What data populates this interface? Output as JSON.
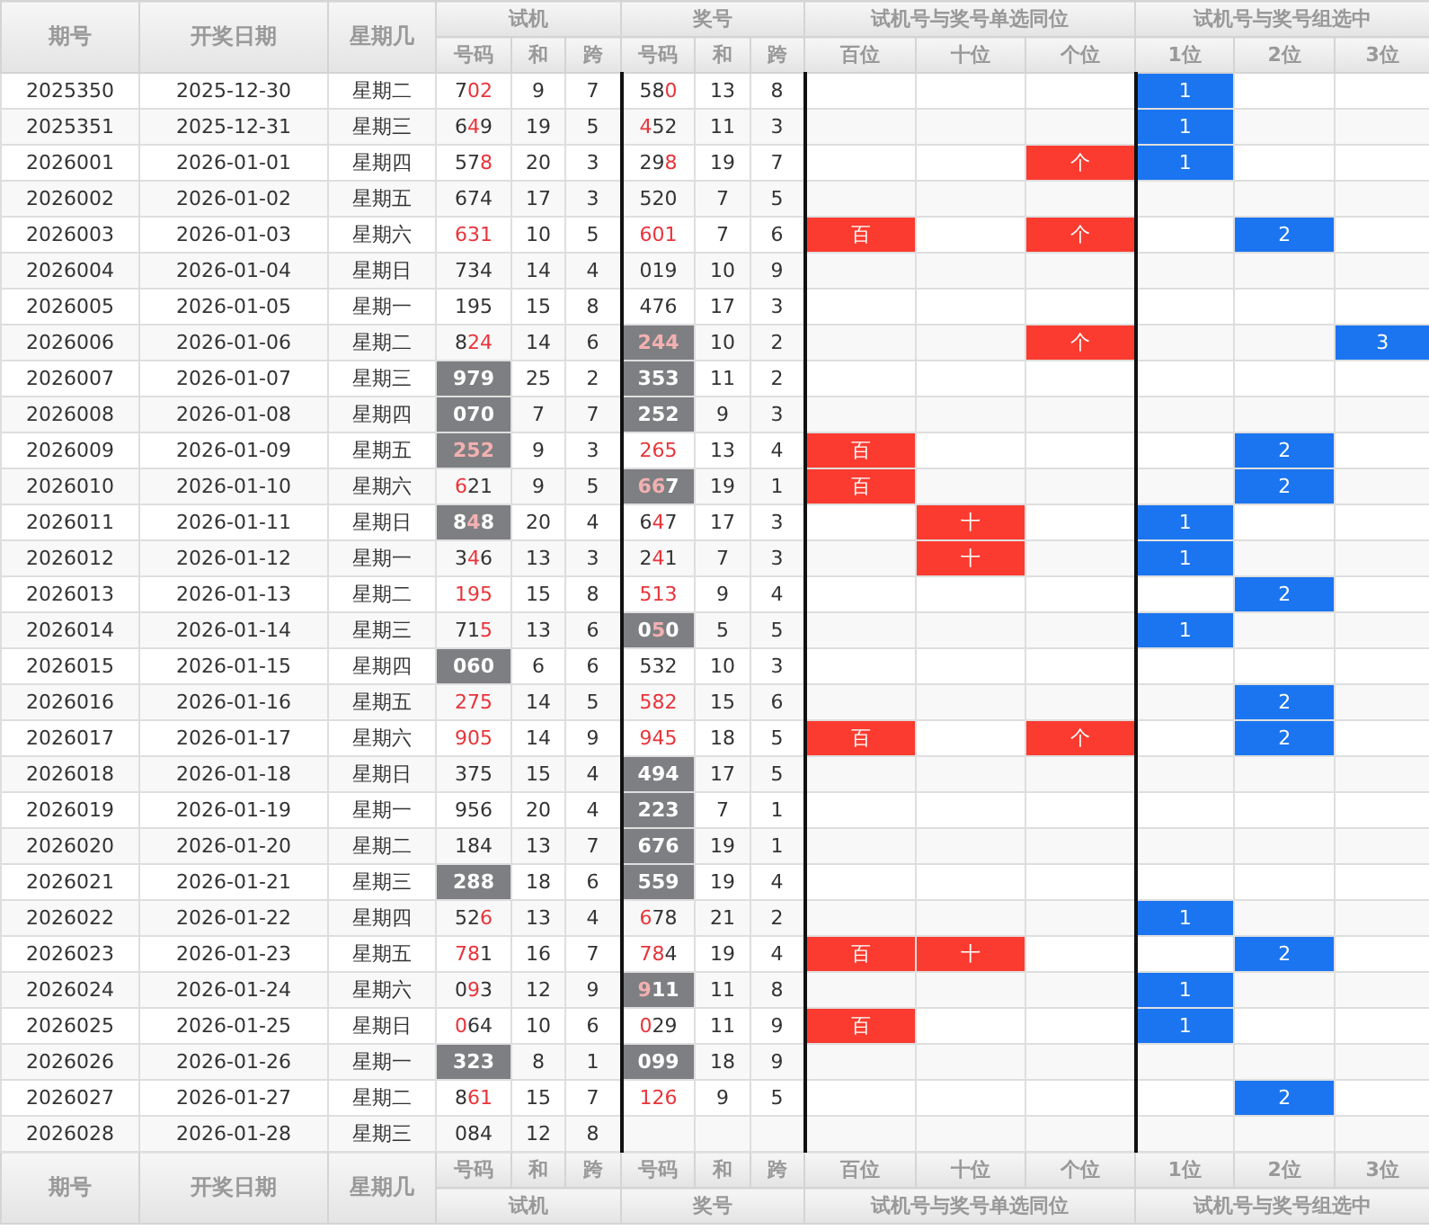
{
  "header": {
    "fixed": [
      "期号",
      "开奖日期",
      "星期几"
    ],
    "groups": [
      {
        "title": "试机",
        "columns": [
          "号码",
          "和",
          "跨"
        ]
      },
      {
        "title": "奖号",
        "columns": [
          "号码",
          "和",
          "跨"
        ]
      },
      {
        "title": "试机号与奖号单选同位",
        "columns": [
          "百位",
          "十位",
          "个位"
        ]
      },
      {
        "title": "试机号与奖号组选中",
        "columns": [
          "1位",
          "2位",
          "3位"
        ]
      }
    ]
  },
  "rows": [
    {
      "issue": "2025350",
      "date": "2025-12-30",
      "weekday": "星期二",
      "trial": {
        "number": "702",
        "hits": [
          false,
          true,
          true
        ],
        "shaded": false
      },
      "trial_sum": "9",
      "trial_span": "7",
      "draw": {
        "number": "580",
        "hits": [
          false,
          false,
          true
        ],
        "shaded": false
      },
      "draw_sum": "13",
      "draw_span": "8",
      "single": [
        {
          "hit": false
        },
        {
          "hit": false
        },
        {
          "hit": false
        }
      ],
      "group": [
        {
          "hit": true,
          "text": "1"
        },
        {
          "hit": false
        },
        {
          "hit": false
        }
      ]
    },
    {
      "issue": "2025351",
      "date": "2025-12-31",
      "weekday": "星期三",
      "trial": {
        "number": "649",
        "hits": [
          false,
          true,
          false
        ],
        "shaded": false
      },
      "trial_sum": "19",
      "trial_span": "5",
      "draw": {
        "number": "452",
        "hits": [
          true,
          false,
          false
        ],
        "shaded": false
      },
      "draw_sum": "11",
      "draw_span": "3",
      "single": [
        {
          "hit": false
        },
        {
          "hit": false
        },
        {
          "hit": false
        }
      ],
      "group": [
        {
          "hit": true,
          "text": "1"
        },
        {
          "hit": false
        },
        {
          "hit": false
        }
      ]
    },
    {
      "issue": "2026001",
      "date": "2026-01-01",
      "weekday": "星期四",
      "trial": {
        "number": "578",
        "hits": [
          false,
          false,
          true
        ],
        "shaded": false
      },
      "trial_sum": "20",
      "trial_span": "3",
      "draw": {
        "number": "298",
        "hits": [
          false,
          false,
          true
        ],
        "shaded": false
      },
      "draw_sum": "19",
      "draw_span": "7",
      "single": [
        {
          "hit": false
        },
        {
          "hit": false
        },
        {
          "hit": true,
          "text": "个"
        }
      ],
      "group": [
        {
          "hit": true,
          "text": "1"
        },
        {
          "hit": false
        },
        {
          "hit": false
        }
      ]
    },
    {
      "issue": "2026002",
      "date": "2026-01-02",
      "weekday": "星期五",
      "trial": {
        "number": "674",
        "hits": [
          false,
          false,
          false
        ],
        "shaded": false
      },
      "trial_sum": "17",
      "trial_span": "3",
      "draw": {
        "number": "520",
        "hits": [
          false,
          false,
          false
        ],
        "shaded": false
      },
      "draw_sum": "7",
      "draw_span": "5",
      "single": [
        {
          "hit": false
        },
        {
          "hit": false
        },
        {
          "hit": false
        }
      ],
      "group": [
        {
          "hit": false
        },
        {
          "hit": false
        },
        {
          "hit": false
        }
      ]
    },
    {
      "issue": "2026003",
      "date": "2026-01-03",
      "weekday": "星期六",
      "trial": {
        "number": "631",
        "hits": [
          true,
          true,
          true
        ],
        "shaded": false
      },
      "trial_sum": "10",
      "trial_span": "5",
      "draw": {
        "number": "601",
        "hits": [
          true,
          true,
          true
        ],
        "shaded": false
      },
      "draw_sum": "7",
      "draw_span": "6",
      "single": [
        {
          "hit": true,
          "text": "百"
        },
        {
          "hit": false
        },
        {
          "hit": true,
          "text": "个"
        }
      ],
      "group": [
        {
          "hit": false
        },
        {
          "hit": true,
          "text": "2"
        },
        {
          "hit": false
        }
      ]
    },
    {
      "issue": "2026004",
      "date": "2026-01-04",
      "weekday": "星期日",
      "trial": {
        "number": "734",
        "hits": [
          false,
          false,
          false
        ],
        "shaded": false
      },
      "trial_sum": "14",
      "trial_span": "4",
      "draw": {
        "number": "019",
        "hits": [
          false,
          false,
          false
        ],
        "shaded": false
      },
      "draw_sum": "10",
      "draw_span": "9",
      "single": [
        {
          "hit": false
        },
        {
          "hit": false
        },
        {
          "hit": false
        }
      ],
      "group": [
        {
          "hit": false
        },
        {
          "hit": false
        },
        {
          "hit": false
        }
      ]
    },
    {
      "issue": "2026005",
      "date": "2026-01-05",
      "weekday": "星期一",
      "trial": {
        "number": "195",
        "hits": [
          false,
          false,
          false
        ],
        "shaded": false
      },
      "trial_sum": "15",
      "trial_span": "8",
      "draw": {
        "number": "476",
        "hits": [
          false,
          false,
          false
        ],
        "shaded": false
      },
      "draw_sum": "17",
      "draw_span": "3",
      "single": [
        {
          "hit": false
        },
        {
          "hit": false
        },
        {
          "hit": false
        }
      ],
      "group": [
        {
          "hit": false
        },
        {
          "hit": false
        },
        {
          "hit": false
        }
      ]
    },
    {
      "issue": "2026006",
      "date": "2026-01-06",
      "weekday": "星期二",
      "trial": {
        "number": "824",
        "hits": [
          false,
          true,
          true
        ],
        "shaded": false
      },
      "trial_sum": "14",
      "trial_span": "6",
      "draw": {
        "number": "244",
        "hits": [
          true,
          true,
          true
        ],
        "shaded": true
      },
      "draw_sum": "10",
      "draw_span": "2",
      "single": [
        {
          "hit": false
        },
        {
          "hit": false
        },
        {
          "hit": true,
          "text": "个"
        }
      ],
      "group": [
        {
          "hit": false
        },
        {
          "hit": false
        },
        {
          "hit": true,
          "text": "3"
        }
      ]
    },
    {
      "issue": "2026007",
      "date": "2026-01-07",
      "weekday": "星期三",
      "trial": {
        "number": "979",
        "hits": [
          false,
          false,
          false
        ],
        "shaded": true
      },
      "trial_sum": "25",
      "trial_span": "2",
      "draw": {
        "number": "353",
        "hits": [
          false,
          false,
          false
        ],
        "shaded": true
      },
      "draw_sum": "11",
      "draw_span": "2",
      "single": [
        {
          "hit": false
        },
        {
          "hit": false
        },
        {
          "hit": false
        }
      ],
      "group": [
        {
          "hit": false
        },
        {
          "hit": false
        },
        {
          "hit": false
        }
      ]
    },
    {
      "issue": "2026008",
      "date": "2026-01-08",
      "weekday": "星期四",
      "trial": {
        "number": "070",
        "hits": [
          false,
          false,
          false
        ],
        "shaded": true
      },
      "trial_sum": "7",
      "trial_span": "7",
      "draw": {
        "number": "252",
        "hits": [
          false,
          false,
          false
        ],
        "shaded": true
      },
      "draw_sum": "9",
      "draw_span": "3",
      "single": [
        {
          "hit": false
        },
        {
          "hit": false
        },
        {
          "hit": false
        }
      ],
      "group": [
        {
          "hit": false
        },
        {
          "hit": false
        },
        {
          "hit": false
        }
      ]
    },
    {
      "issue": "2026009",
      "date": "2026-01-09",
      "weekday": "星期五",
      "trial": {
        "number": "252",
        "hits": [
          true,
          true,
          true
        ],
        "shaded": true
      },
      "trial_sum": "9",
      "trial_span": "3",
      "draw": {
        "number": "265",
        "hits": [
          true,
          true,
          true
        ],
        "shaded": false
      },
      "draw_sum": "13",
      "draw_span": "4",
      "single": [
        {
          "hit": true,
          "text": "百"
        },
        {
          "hit": false
        },
        {
          "hit": false
        }
      ],
      "group": [
        {
          "hit": false
        },
        {
          "hit": true,
          "text": "2"
        },
        {
          "hit": false
        }
      ]
    },
    {
      "issue": "2026010",
      "date": "2026-01-10",
      "weekday": "星期六",
      "trial": {
        "number": "621",
        "hits": [
          true,
          false,
          false
        ],
        "shaded": false
      },
      "trial_sum": "9",
      "trial_span": "5",
      "draw": {
        "number": "667",
        "hits": [
          true,
          true,
          false
        ],
        "shaded": true
      },
      "draw_sum": "19",
      "draw_span": "1",
      "single": [
        {
          "hit": true,
          "text": "百"
        },
        {
          "hit": false
        },
        {
          "hit": false
        }
      ],
      "group": [
        {
          "hit": false
        },
        {
          "hit": true,
          "text": "2"
        },
        {
          "hit": false
        }
      ]
    },
    {
      "issue": "2026011",
      "date": "2026-01-11",
      "weekday": "星期日",
      "trial": {
        "number": "848",
        "hits": [
          false,
          true,
          false
        ],
        "shaded": true
      },
      "trial_sum": "20",
      "trial_span": "4",
      "draw": {
        "number": "647",
        "hits": [
          false,
          true,
          false
        ],
        "shaded": false
      },
      "draw_sum": "17",
      "draw_span": "3",
      "single": [
        {
          "hit": false
        },
        {
          "hit": true,
          "text": "十"
        },
        {
          "hit": false
        }
      ],
      "group": [
        {
          "hit": true,
          "text": "1"
        },
        {
          "hit": false
        },
        {
          "hit": false
        }
      ]
    },
    {
      "issue": "2026012",
      "date": "2026-01-12",
      "weekday": "星期一",
      "trial": {
        "number": "346",
        "hits": [
          false,
          true,
          false
        ],
        "shaded": false
      },
      "trial_sum": "13",
      "trial_span": "3",
      "draw": {
        "number": "241",
        "hits": [
          false,
          true,
          false
        ],
        "shaded": false
      },
      "draw_sum": "7",
      "draw_span": "3",
      "single": [
        {
          "hit": false
        },
        {
          "hit": true,
          "text": "十"
        },
        {
          "hit": false
        }
      ],
      "group": [
        {
          "hit": true,
          "text": "1"
        },
        {
          "hit": false
        },
        {
          "hit": false
        }
      ]
    },
    {
      "issue": "2026013",
      "date": "2026-01-13",
      "weekday": "星期二",
      "trial": {
        "number": "195",
        "hits": [
          true,
          true,
          true
        ],
        "shaded": false
      },
      "trial_sum": "15",
      "trial_span": "8",
      "draw": {
        "number": "513",
        "hits": [
          true,
          true,
          true
        ],
        "shaded": false
      },
      "draw_sum": "9",
      "draw_span": "4",
      "single": [
        {
          "hit": false
        },
        {
          "hit": false
        },
        {
          "hit": false
        }
      ],
      "group": [
        {
          "hit": false
        },
        {
          "hit": true,
          "text": "2"
        },
        {
          "hit": false
        }
      ]
    },
    {
      "issue": "2026014",
      "date": "2026-01-14",
      "weekday": "星期三",
      "trial": {
        "number": "715",
        "hits": [
          false,
          false,
          true
        ],
        "shaded": false
      },
      "trial_sum": "13",
      "trial_span": "6",
      "draw": {
        "number": "050",
        "hits": [
          false,
          true,
          false
        ],
        "shaded": true
      },
      "draw_sum": "5",
      "draw_span": "5",
      "single": [
        {
          "hit": false
        },
        {
          "hit": false
        },
        {
          "hit": false
        }
      ],
      "group": [
        {
          "hit": true,
          "text": "1"
        },
        {
          "hit": false
        },
        {
          "hit": false
        }
      ]
    },
    {
      "issue": "2026015",
      "date": "2026-01-15",
      "weekday": "星期四",
      "trial": {
        "number": "060",
        "hits": [
          false,
          false,
          false
        ],
        "shaded": true
      },
      "trial_sum": "6",
      "trial_span": "6",
      "draw": {
        "number": "532",
        "hits": [
          false,
          false,
          false
        ],
        "shaded": false
      },
      "draw_sum": "10",
      "draw_span": "3",
      "single": [
        {
          "hit": false
        },
        {
          "hit": false
        },
        {
          "hit": false
        }
      ],
      "group": [
        {
          "hit": false
        },
        {
          "hit": false
        },
        {
          "hit": false
        }
      ]
    },
    {
      "issue": "2026016",
      "date": "2026-01-16",
      "weekday": "星期五",
      "trial": {
        "number": "275",
        "hits": [
          true,
          true,
          true
        ],
        "shaded": false
      },
      "trial_sum": "14",
      "trial_span": "5",
      "draw": {
        "number": "582",
        "hits": [
          true,
          true,
          true
        ],
        "shaded": false
      },
      "draw_sum": "15",
      "draw_span": "6",
      "single": [
        {
          "hit": false
        },
        {
          "hit": false
        },
        {
          "hit": false
        }
      ],
      "group": [
        {
          "hit": false
        },
        {
          "hit": true,
          "text": "2"
        },
        {
          "hit": false
        }
      ]
    },
    {
      "issue": "2026017",
      "date": "2026-01-17",
      "weekday": "星期六",
      "trial": {
        "number": "905",
        "hits": [
          true,
          true,
          true
        ],
        "shaded": false
      },
      "trial_sum": "14",
      "trial_span": "9",
      "draw": {
        "number": "945",
        "hits": [
          true,
          true,
          true
        ],
        "shaded": false
      },
      "draw_sum": "18",
      "draw_span": "5",
      "single": [
        {
          "hit": true,
          "text": "百"
        },
        {
          "hit": false
        },
        {
          "hit": true,
          "text": "个"
        }
      ],
      "group": [
        {
          "hit": false
        },
        {
          "hit": true,
          "text": "2"
        },
        {
          "hit": false
        }
      ]
    },
    {
      "issue": "2026018",
      "date": "2026-01-18",
      "weekday": "星期日",
      "trial": {
        "number": "375",
        "hits": [
          false,
          false,
          false
        ],
        "shaded": false
      },
      "trial_sum": "15",
      "trial_span": "4",
      "draw": {
        "number": "494",
        "hits": [
          false,
          false,
          false
        ],
        "shaded": true
      },
      "draw_sum": "17",
      "draw_span": "5",
      "single": [
        {
          "hit": false
        },
        {
          "hit": false
        },
        {
          "hit": false
        }
      ],
      "group": [
        {
          "hit": false
        },
        {
          "hit": false
        },
        {
          "hit": false
        }
      ]
    },
    {
      "issue": "2026019",
      "date": "2026-01-19",
      "weekday": "星期一",
      "trial": {
        "number": "956",
        "hits": [
          false,
          false,
          false
        ],
        "shaded": false
      },
      "trial_sum": "20",
      "trial_span": "4",
      "draw": {
        "number": "223",
        "hits": [
          false,
          false,
          false
        ],
        "shaded": true
      },
      "draw_sum": "7",
      "draw_span": "1",
      "single": [
        {
          "hit": false
        },
        {
          "hit": false
        },
        {
          "hit": false
        }
      ],
      "group": [
        {
          "hit": false
        },
        {
          "hit": false
        },
        {
          "hit": false
        }
      ]
    },
    {
      "issue": "2026020",
      "date": "2026-01-20",
      "weekday": "星期二",
      "trial": {
        "number": "184",
        "hits": [
          false,
          false,
          false
        ],
        "shaded": false
      },
      "trial_sum": "13",
      "trial_span": "7",
      "draw": {
        "number": "676",
        "hits": [
          false,
          false,
          false
        ],
        "shaded": true
      },
      "draw_sum": "19",
      "draw_span": "1",
      "single": [
        {
          "hit": false
        },
        {
          "hit": false
        },
        {
          "hit": false
        }
      ],
      "group": [
        {
          "hit": false
        },
        {
          "hit": false
        },
        {
          "hit": false
        }
      ]
    },
    {
      "issue": "2026021",
      "date": "2026-01-21",
      "weekday": "星期三",
      "trial": {
        "number": "288",
        "hits": [
          false,
          false,
          false
        ],
        "shaded": true
      },
      "trial_sum": "18",
      "trial_span": "6",
      "draw": {
        "number": "559",
        "hits": [
          false,
          false,
          false
        ],
        "shaded": true
      },
      "draw_sum": "19",
      "draw_span": "4",
      "single": [
        {
          "hit": false
        },
        {
          "hit": false
        },
        {
          "hit": false
        }
      ],
      "group": [
        {
          "hit": false
        },
        {
          "hit": false
        },
        {
          "hit": false
        }
      ]
    },
    {
      "issue": "2026022",
      "date": "2026-01-22",
      "weekday": "星期四",
      "trial": {
        "number": "526",
        "hits": [
          false,
          false,
          true
        ],
        "shaded": false
      },
      "trial_sum": "13",
      "trial_span": "4",
      "draw": {
        "number": "678",
        "hits": [
          true,
          false,
          false
        ],
        "shaded": false
      },
      "draw_sum": "21",
      "draw_span": "2",
      "single": [
        {
          "hit": false
        },
        {
          "hit": false
        },
        {
          "hit": false
        }
      ],
      "group": [
        {
          "hit": true,
          "text": "1"
        },
        {
          "hit": false
        },
        {
          "hit": false
        }
      ]
    },
    {
      "issue": "2026023",
      "date": "2026-01-23",
      "weekday": "星期五",
      "trial": {
        "number": "781",
        "hits": [
          true,
          true,
          false
        ],
        "shaded": false
      },
      "trial_sum": "16",
      "trial_span": "7",
      "draw": {
        "number": "784",
        "hits": [
          true,
          true,
          false
        ],
        "shaded": false
      },
      "draw_sum": "19",
      "draw_span": "4",
      "single": [
        {
          "hit": true,
          "text": "百"
        },
        {
          "hit": true,
          "text": "十"
        },
        {
          "hit": false
        }
      ],
      "group": [
        {
          "hit": false
        },
        {
          "hit": true,
          "text": "2"
        },
        {
          "hit": false
        }
      ]
    },
    {
      "issue": "2026024",
      "date": "2026-01-24",
      "weekday": "星期六",
      "trial": {
        "number": "093",
        "hits": [
          false,
          true,
          false
        ],
        "shaded": false
      },
      "trial_sum": "12",
      "trial_span": "9",
      "draw": {
        "number": "911",
        "hits": [
          true,
          false,
          false
        ],
        "shaded": true
      },
      "draw_sum": "11",
      "draw_span": "8",
      "single": [
        {
          "hit": false
        },
        {
          "hit": false
        },
        {
          "hit": false
        }
      ],
      "group": [
        {
          "hit": true,
          "text": "1"
        },
        {
          "hit": false
        },
        {
          "hit": false
        }
      ]
    },
    {
      "issue": "2026025",
      "date": "2026-01-25",
      "weekday": "星期日",
      "trial": {
        "number": "064",
        "hits": [
          true,
          false,
          false
        ],
        "shaded": false
      },
      "trial_sum": "10",
      "trial_span": "6",
      "draw": {
        "number": "029",
        "hits": [
          true,
          false,
          false
        ],
        "shaded": false
      },
      "draw_sum": "11",
      "draw_span": "9",
      "single": [
        {
          "hit": true,
          "text": "百"
        },
        {
          "hit": false
        },
        {
          "hit": false
        }
      ],
      "group": [
        {
          "hit": true,
          "text": "1"
        },
        {
          "hit": false
        },
        {
          "hit": false
        }
      ]
    },
    {
      "issue": "2026026",
      "date": "2026-01-26",
      "weekday": "星期一",
      "trial": {
        "number": "323",
        "hits": [
          false,
          false,
          false
        ],
        "shaded": true
      },
      "trial_sum": "8",
      "trial_span": "1",
      "draw": {
        "number": "099",
        "hits": [
          false,
          false,
          false
        ],
        "shaded": true
      },
      "draw_sum": "18",
      "draw_span": "9",
      "single": [
        {
          "hit": false
        },
        {
          "hit": false
        },
        {
          "hit": false
        }
      ],
      "group": [
        {
          "hit": false
        },
        {
          "hit": false
        },
        {
          "hit": false
        }
      ]
    },
    {
      "issue": "2026027",
      "date": "2026-01-27",
      "weekday": "星期二",
      "trial": {
        "number": "861",
        "hits": [
          false,
          true,
          true
        ],
        "shaded": false
      },
      "trial_sum": "15",
      "trial_span": "7",
      "draw": {
        "number": "126",
        "hits": [
          true,
          true,
          true
        ],
        "shaded": false
      },
      "draw_sum": "9",
      "draw_span": "5",
      "single": [
        {
          "hit": false
        },
        {
          "hit": false
        },
        {
          "hit": false
        }
      ],
      "group": [
        {
          "hit": false
        },
        {
          "hit": true,
          "text": "2"
        },
        {
          "hit": false
        }
      ]
    },
    {
      "issue": "2026028",
      "date": "2026-01-28",
      "weekday": "星期三",
      "trial": {
        "number": "084",
        "hits": [
          false,
          false,
          false
        ],
        "shaded": false
      },
      "trial_sum": "12",
      "trial_span": "8",
      "single": [
        {
          "hit": false
        },
        {
          "hit": false
        },
        {
          "hit": false
        }
      ],
      "group": [
        {
          "hit": false
        },
        {
          "hit": false
        },
        {
          "hit": false
        }
      ]
    }
  ],
  "footer": {
    "fixed": [
      "期号",
      "开奖日期",
      "星期几"
    ],
    "groups": [
      {
        "title": "试机",
        "columns": [
          "号码",
          "和",
          "跨"
        ]
      },
      {
        "title": "奖号",
        "columns": [
          "号码",
          "和",
          "跨"
        ]
      },
      {
        "title": "试机号与奖号单选同位",
        "columns": [
          "百位",
          "十位",
          "个位"
        ]
      },
      {
        "title": "试机号与奖号组选中",
        "columns": [
          "1位",
          "2位",
          "3位"
        ]
      }
    ]
  }
}
